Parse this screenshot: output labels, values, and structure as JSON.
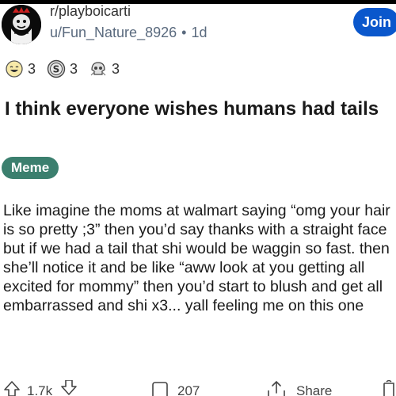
{
  "header": {
    "subreddit": "r/playboicarti",
    "author": "u/Fun_Nature_8926",
    "separator": "•",
    "age": "1d",
    "join_label": "Join"
  },
  "awards": [
    {
      "icon": "laughing-face-icon",
      "count": "3"
    },
    {
      "icon": "silver-coin-icon",
      "count": "3"
    },
    {
      "icon": "skull-award-icon",
      "count": "3"
    }
  ],
  "post": {
    "title": "I think everyone wishes humans had tails",
    "flair": "Meme",
    "body": "Like imagine the moms at walmart saying “omg your hair is so pretty ;3” then you’d say thanks with a straight face but if we had a tail that shi would be waggin so fast. then she’ll notice it and be like “aww look at you getting all excited for mommy” then you’d start to blush and get all embarrassed and shi x3... yall feeling me on this one"
  },
  "actions": {
    "upvote_count": "1.7k",
    "comment_count": "207",
    "share_label": "Share"
  },
  "colors": {
    "join_bg": "#0a57cc",
    "flair_bg": "#3b7f6e",
    "meta_text": "#5a6a7e"
  }
}
